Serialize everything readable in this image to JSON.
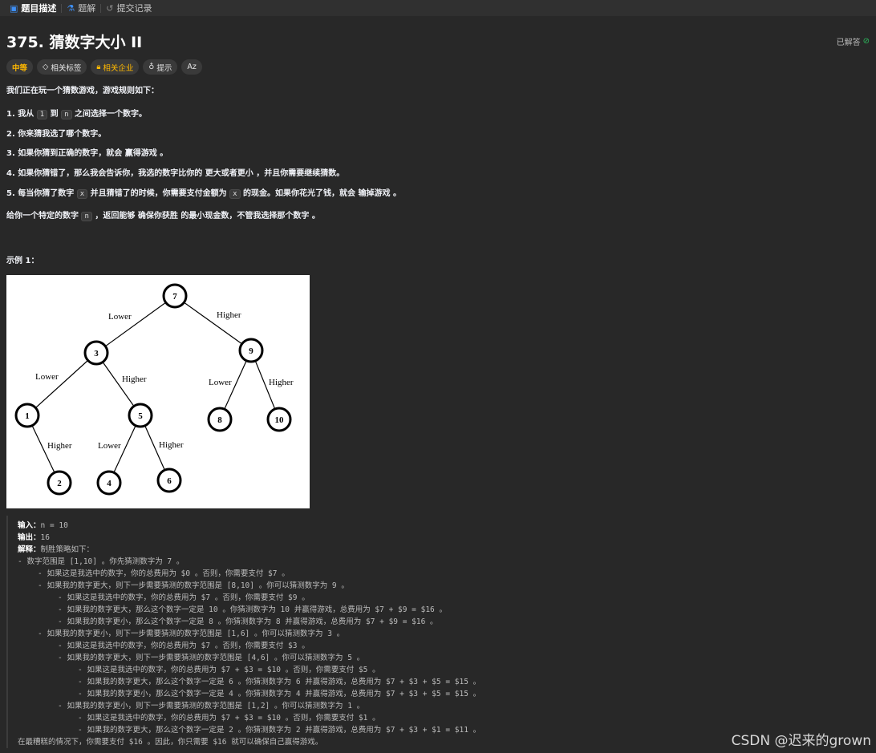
{
  "tabs": [
    {
      "label": "题目描述",
      "icon": "description-icon"
    },
    {
      "label": "题解",
      "icon": "flask-icon"
    },
    {
      "label": "提交记录",
      "icon": "history-icon"
    }
  ],
  "problem": {
    "title": "375. 猜数字大小 II",
    "status": "已解答"
  },
  "tags": {
    "difficulty": "中等",
    "related_tags": "相关标签",
    "related_companies": "相关企业",
    "hints": "提示",
    "font_toggle": "Az"
  },
  "description": {
    "intro": "我们正在玩一个猜数游戏，游戏规则如下：",
    "rule1": {
      "a": "1. 我从 ",
      "c1": "1",
      "b": " 到 ",
      "c2": "n",
      "d": " 之间选择一个数字。"
    },
    "rule2": "2. 你来猜我选了哪个数字。",
    "rule3": "3. 如果你猜到正确的数字，就会 赢得游戏 。",
    "rule4": "4. 如果你猜错了，那么我会告诉你，我选的数字比你的 更大或者更小 ，并且你需要继续猜数。",
    "rule5": {
      "a": "5. 每当你猜了数字 ",
      "c1": "x",
      "b": " 并且猜错了的时候，你需要支付金额为 ",
      "c2": "x",
      "d": " 的现金。如果你花光了钱，就会 输掉游戏 。"
    },
    "task": {
      "a": "给你一个特定的数字 ",
      "c1": "n",
      "b": " ，返回能够 确保你获胜 的最小现金数，不管我选择那个数字 。"
    }
  },
  "example": {
    "title": "示例 1：",
    "tree": {
      "nodes": [
        "7",
        "3",
        "9",
        "1",
        "5",
        "8",
        "10",
        "2",
        "4",
        "6"
      ],
      "edge_labels": {
        "lower": "Lower",
        "higher": "Higher"
      }
    },
    "input_label": "输入：",
    "input_value": "n = 10",
    "output_label": "输出：",
    "output_value": "16",
    "explain_label": "解释：",
    "explain_value": "制胜策略如下：",
    "lines": [
      "- 数字范围是 [1,10] 。你先猜测数字为 7 。",
      "    - 如果这是我选中的数字，你的总费用为 $0 。否则，你需要支付 $7 。",
      "    - 如果我的数字更大，则下一步需要猜测的数字范围是 [8,10] 。你可以猜测数字为 9 。",
      "        - 如果这是我选中的数字，你的总费用为 $7 。否则，你需要支付 $9 。",
      "        - 如果我的数字更大，那么这个数字一定是 10 。你猜测数字为 10 并赢得游戏，总费用为 $7 + $9 = $16 。",
      "        - 如果我的数字更小，那么这个数字一定是 8 。你猜测数字为 8 并赢得游戏，总费用为 $7 + $9 = $16 。",
      "    - 如果我的数字更小，则下一步需要猜测的数字范围是 [1,6] 。你可以猜测数字为 3 。",
      "        - 如果这是我选中的数字，你的总费用为 $7 。否则，你需要支付 $3 。",
      "        - 如果我的数字更大，则下一步需要猜测的数字范围是 [4,6] 。你可以猜测数字为 5 。",
      "            - 如果这是我选中的数字，你的总费用为 $7 + $3 = $10 。否则，你需要支付 $5 。",
      "            - 如果我的数字更大，那么这个数字一定是 6 。你猜测数字为 6 并赢得游戏，总费用为 $7 + $3 + $5 = $15 。",
      "            - 如果我的数字更小，那么这个数字一定是 4 。你猜测数字为 4 并赢得游戏，总费用为 $7 + $3 + $5 = $15 。",
      "        - 如果我的数字更小，则下一步需要猜测的数字范围是 [1,2] 。你可以猜测数字为 1 。",
      "            - 如果这是我选中的数字，你的总费用为 $7 + $3 = $10 。否则，你需要支付 $1 。",
      "            - 如果我的数字更大，那么这个数字一定是 2 。你猜测数字为 2 并赢得游戏，总费用为 $7 + $3 + $1 = $11 。",
      "在最糟糕的情况下，你需要支付 $16 。因此，你只需要 $16 就可以确保自己赢得游戏。"
    ]
  },
  "watermark": "CSDN @迟来的grown"
}
